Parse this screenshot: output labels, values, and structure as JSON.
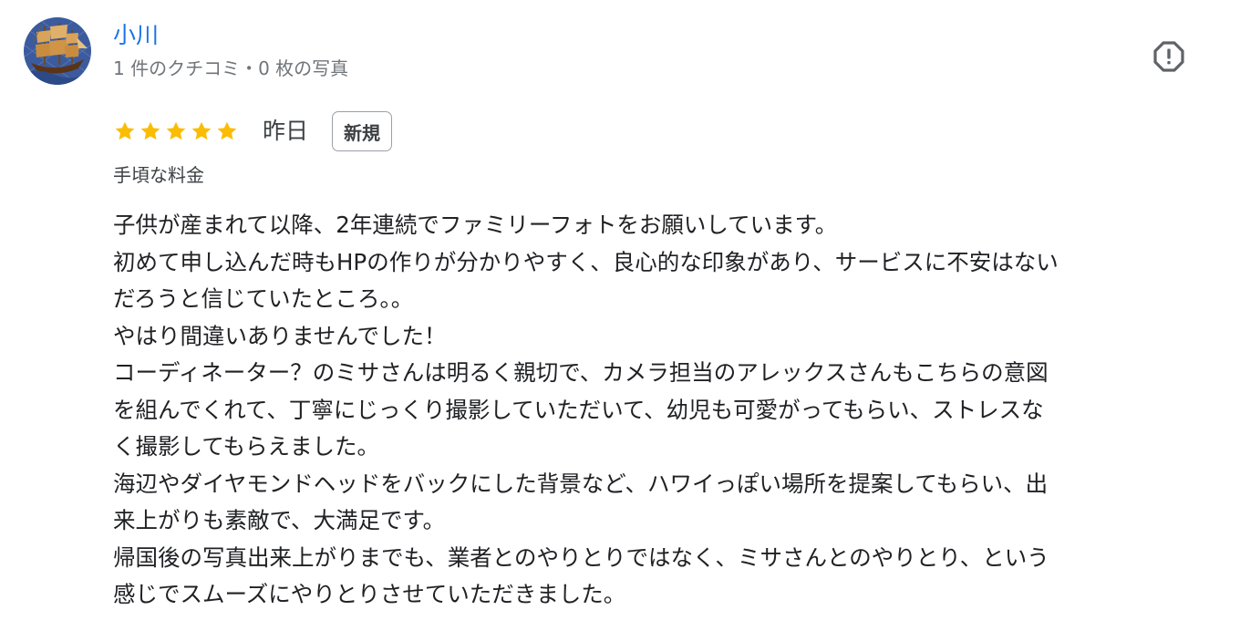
{
  "reviewer": {
    "name": "小川",
    "meta": "1 件のクチコミ・0 枚の写真"
  },
  "review": {
    "rating": 5,
    "max_rating": 5,
    "date": "昨日",
    "badge": "新規",
    "tag": "手頃な料金",
    "lines": [
      "子供が産まれて以降、2年連続でファミリーフォトをお願いしています。",
      "初めて申し込んだ時もHPの作りが分かりやすく、良心的な印象があり、サービスに不安はない",
      "だろうと信じていたところ。。",
      "やはり間違いありませんでした！",
      "コーディネーター？のミサさんは明るく親切で、カメラ担当のアレックスさんもこちらの意図",
      "を組んでくれて、丁寧にじっくり撮影していただいて、幼児も可愛がってもらい、ストレスな",
      "く撮影してもらえました。",
      "海辺やダイヤモンドヘッドをバックにした背景など、ハワイっぽい場所を提案してもらい、出",
      "来上がりも素敵で、大満足です。",
      "帰国後の写真出来上がりまでも、業者とのやりとりではなく、ミサさんとのやりとり、という",
      "感じでスムーズにやりとりさせていただきました。"
    ]
  },
  "icons": {
    "report": "report-icon",
    "star": "star-icon",
    "avatar": "ship-avatar"
  },
  "colors": {
    "reviewer_name": "#1a73e8",
    "star_filled": "#fbbc04",
    "meta_text": "#70757a",
    "body_text": "#202124",
    "badge_border": "#9aa0a6"
  }
}
